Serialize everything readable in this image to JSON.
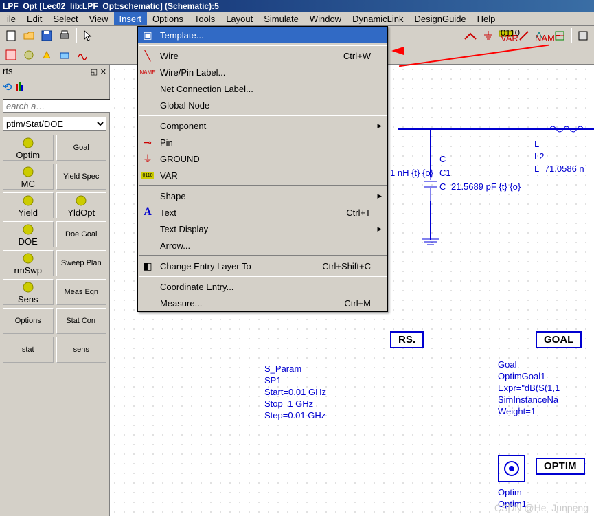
{
  "title": "LPF_Opt [Lec02_lib:LPF_Opt:schematic] (Schematic):5",
  "menubar": [
    "ile",
    "Edit",
    "Select",
    "View",
    "Insert",
    "Options",
    "Tools",
    "Layout",
    "Simulate",
    "Window",
    "DynamicLink",
    "DesignGuide",
    "Help"
  ],
  "active_menu": "Insert",
  "insert_menu": {
    "template": "Template...",
    "wire": "Wire",
    "wire_sc": "Ctrl+W",
    "wirepin": "Wire/Pin Label...",
    "netconn": "Net Connection Label...",
    "global": "Global Node",
    "component": "Component",
    "pin": "Pin",
    "ground": "GROUND",
    "var": "VAR",
    "shape": "Shape",
    "text": "Text",
    "text_sc": "Ctrl+T",
    "textdisp": "Text Display",
    "arrow": "Arrow...",
    "change": "Change Entry Layer To",
    "change_sc": "Ctrl+Shift+C",
    "coord": "Coordinate Entry...",
    "measure": "Measure...",
    "measure_sc": "Ctrl+M"
  },
  "sidebar": {
    "title": "rts",
    "search_ph": "earch a…",
    "select": "ptim/Stat/DOE",
    "buttons": [
      "Optim",
      "Goal",
      "MC",
      "Yield Spec",
      "Yield",
      "YldOpt",
      "DOE",
      "Doe Goal",
      "rmSwp",
      "Sweep Plan",
      "Sens",
      "Meas Eqn",
      "Options",
      "Stat Corr",
      "stat",
      "sens"
    ]
  },
  "schematic": {
    "c1_val": "1 nH {t} {o}",
    "c1": "C1",
    "c1_cap": "C=21.5689 pF {t} {o}",
    "c": "C",
    "l": "L",
    "l2": "L2",
    "l_val": "L=71.0586 n",
    "rs": "RS.",
    "goal": "GOAL",
    "goal_lines": [
      "Goal",
      "OptimGoal1",
      "Expr=\"dB(S(1,1",
      "SimInstanceNa",
      "Weight=1"
    ],
    "sp_lines": [
      "S_Param",
      "SP1",
      "Start=0.01 GHz",
      "Stop=1 GHz",
      "Step=0.01 GHz"
    ],
    "optim": "OPTIM",
    "optim2": "Optim",
    "optim1": "Optim1"
  },
  "watermark": "CSDN @He_Junpeng"
}
